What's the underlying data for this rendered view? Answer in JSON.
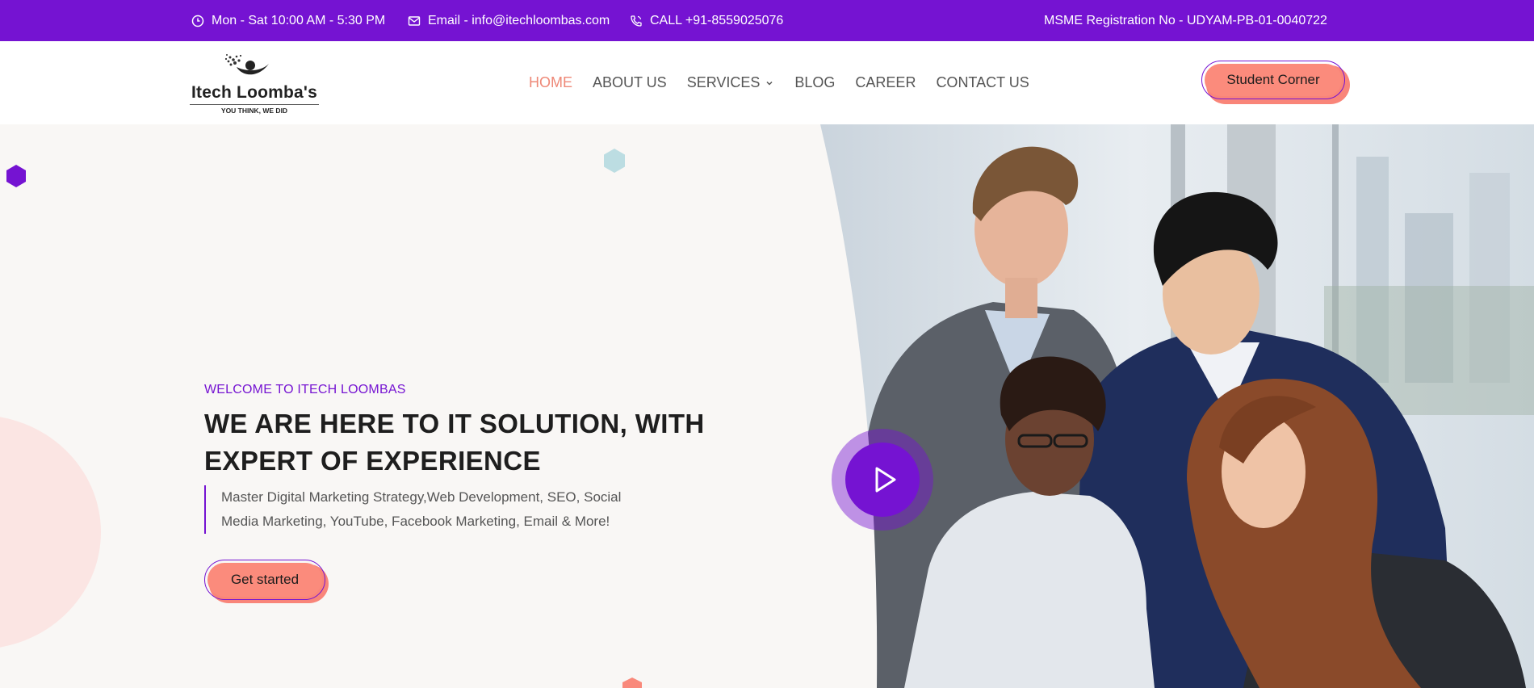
{
  "topbar": {
    "hours": "Mon - Sat 10:00 AM - 5:30 PM",
    "email": "Email - info@itechloombas.com",
    "call": "CALL +91-8559025076",
    "msme": "MSME Registration No - UDYAM-PB-01-0040722"
  },
  "logo": {
    "name": "Itech Loomba's",
    "tagline": "YOU THINK, WE DID"
  },
  "nav": {
    "items": [
      {
        "label": "HOME",
        "active": true
      },
      {
        "label": "ABOUT US"
      },
      {
        "label": "SERVICES",
        "has_dropdown": true
      },
      {
        "label": "BLOG"
      },
      {
        "label": "CAREER"
      },
      {
        "label": "CONTACT US"
      }
    ],
    "cta": "Student Corner"
  },
  "hero": {
    "welcome": "WELCOME TO ITECH LOOMBAS",
    "headline_line1": "WE ARE HERE TO IT SOLUTION, WITH",
    "headline_line2": "EXPERT OF EXPERIENCE",
    "description_line1": "Master Digital Marketing Strategy,Web Development, SEO, Social",
    "description_line2": "Media Marketing, YouTube, Facebook Marketing, Email & More!",
    "cta": "Get started"
  },
  "colors": {
    "brand_purple": "#7513d2",
    "accent_coral": "#fb8b7c",
    "nav_active": "#ee8877"
  }
}
